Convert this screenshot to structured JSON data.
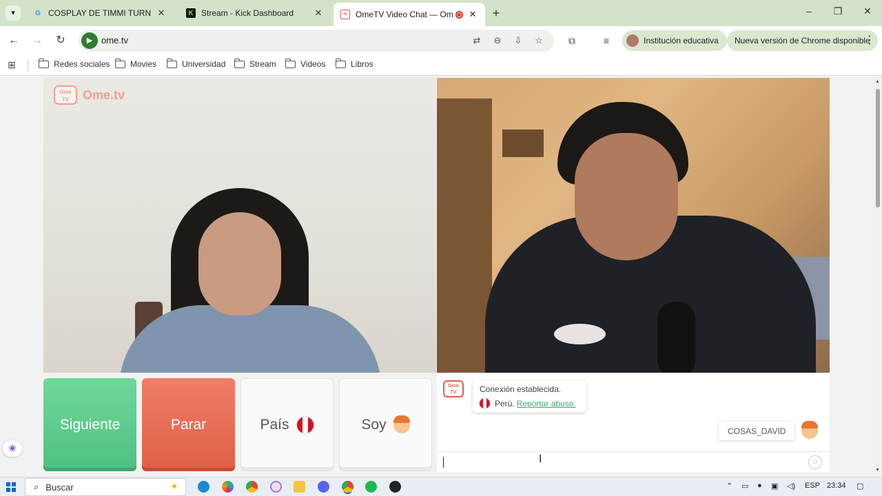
{
  "browser": {
    "tabs": [
      {
        "title": "COSPLAY DE TIMMI TURNER DI",
        "favicon": "google-icon"
      },
      {
        "title": "Stream - Kick Dashboard",
        "favicon": "kick-icon"
      },
      {
        "title": "OmeTV Video Chat — Ome",
        "favicon": "ometv-icon"
      }
    ],
    "url": "ome.tv",
    "profile_label": "Institución educativa",
    "update_label": "Nueva versión de Chrome disponible"
  },
  "bookmarks": [
    "Redes sociales",
    "Movies",
    "Universidad",
    "Stream",
    "Videos",
    "Libros"
  ],
  "page": {
    "logo_text": "Ome.tv",
    "logo_badge": "Ome TV",
    "buttons": {
      "next": "Siguiente",
      "stop": "Parar",
      "country": "País",
      "gender": "Soy"
    },
    "chat": {
      "status": "Conexión establecida.",
      "country": "Perú.",
      "report_link": "Reportar abuso.",
      "username": "COSAS_DAVID"
    }
  },
  "taskbar": {
    "search_placeholder": "Buscar",
    "language": "ESP",
    "time": "23:34"
  },
  "colors": {
    "next_button": "#5ccc8b",
    "stop_button": "#e8684f",
    "brand": "#f0a08a"
  }
}
